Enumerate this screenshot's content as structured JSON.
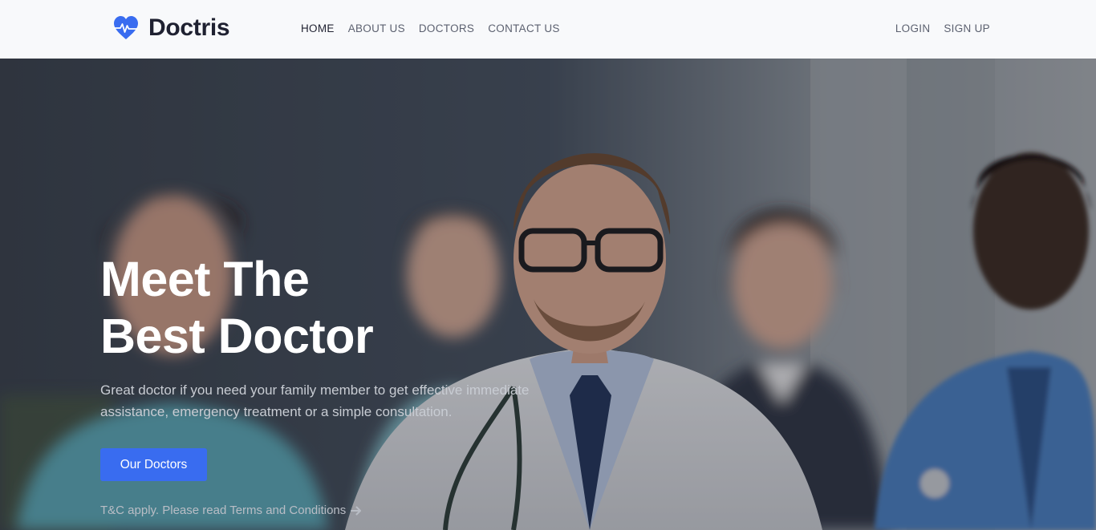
{
  "brand": {
    "name": "Doctris",
    "logo_icon": "heart-pulse-icon",
    "accent": "#396cf0"
  },
  "nav": {
    "items": [
      {
        "label": "HOME",
        "active": true
      },
      {
        "label": "ABOUT US",
        "active": false
      },
      {
        "label": "DOCTORS",
        "active": false
      },
      {
        "label": "CONTACT US",
        "active": false
      }
    ],
    "auth": {
      "login": "LOGIN",
      "signup": "SIGN UP"
    }
  },
  "hero": {
    "title_line1": "Meet The",
    "title_line2": "Best Doctor",
    "description": "Great doctor if you need your family member to get effective immediate assistance, emergency treatment or a simple consultation.",
    "cta_label": "Our Doctors",
    "terms_text": "T&C apply. Please read Terms and Conditions",
    "terms_icon": "arrow-right-icon"
  }
}
